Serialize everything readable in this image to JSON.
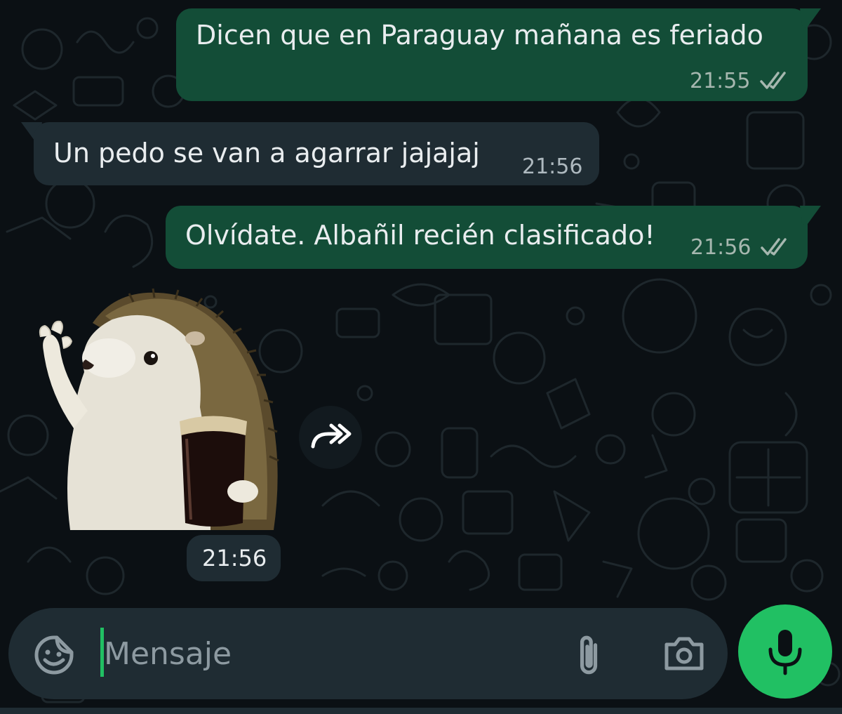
{
  "messages": [
    {
      "direction": "outgoing",
      "text": "Dicen que en Paraguay mañana es feriado",
      "time": "21:55",
      "status": "read"
    },
    {
      "direction": "incoming",
      "text": "Un pedo se van a agarrar jajajaj",
      "time": "21:56"
    },
    {
      "direction": "outgoing",
      "text": "Olvídate. Albañil recién clasificado!",
      "time": "21:56",
      "status": "read"
    },
    {
      "direction": "incoming",
      "type": "sticker",
      "sticker_icon": "hedgehog-with-drink-sticker",
      "time": "21:56"
    }
  ],
  "composer": {
    "placeholder": "Mensaje",
    "value": "",
    "icons": [
      "emoji-sticker-icon",
      "attach-paperclip-icon",
      "camera-icon",
      "microphone-icon"
    ]
  },
  "colors": {
    "background": "#0b1014",
    "outgoing_bubble": "#134d37",
    "incoming_bubble": "#1f2c33",
    "accent_green": "#21c063",
    "text_primary": "#e9edef",
    "text_secondary": "#a6b7af"
  }
}
